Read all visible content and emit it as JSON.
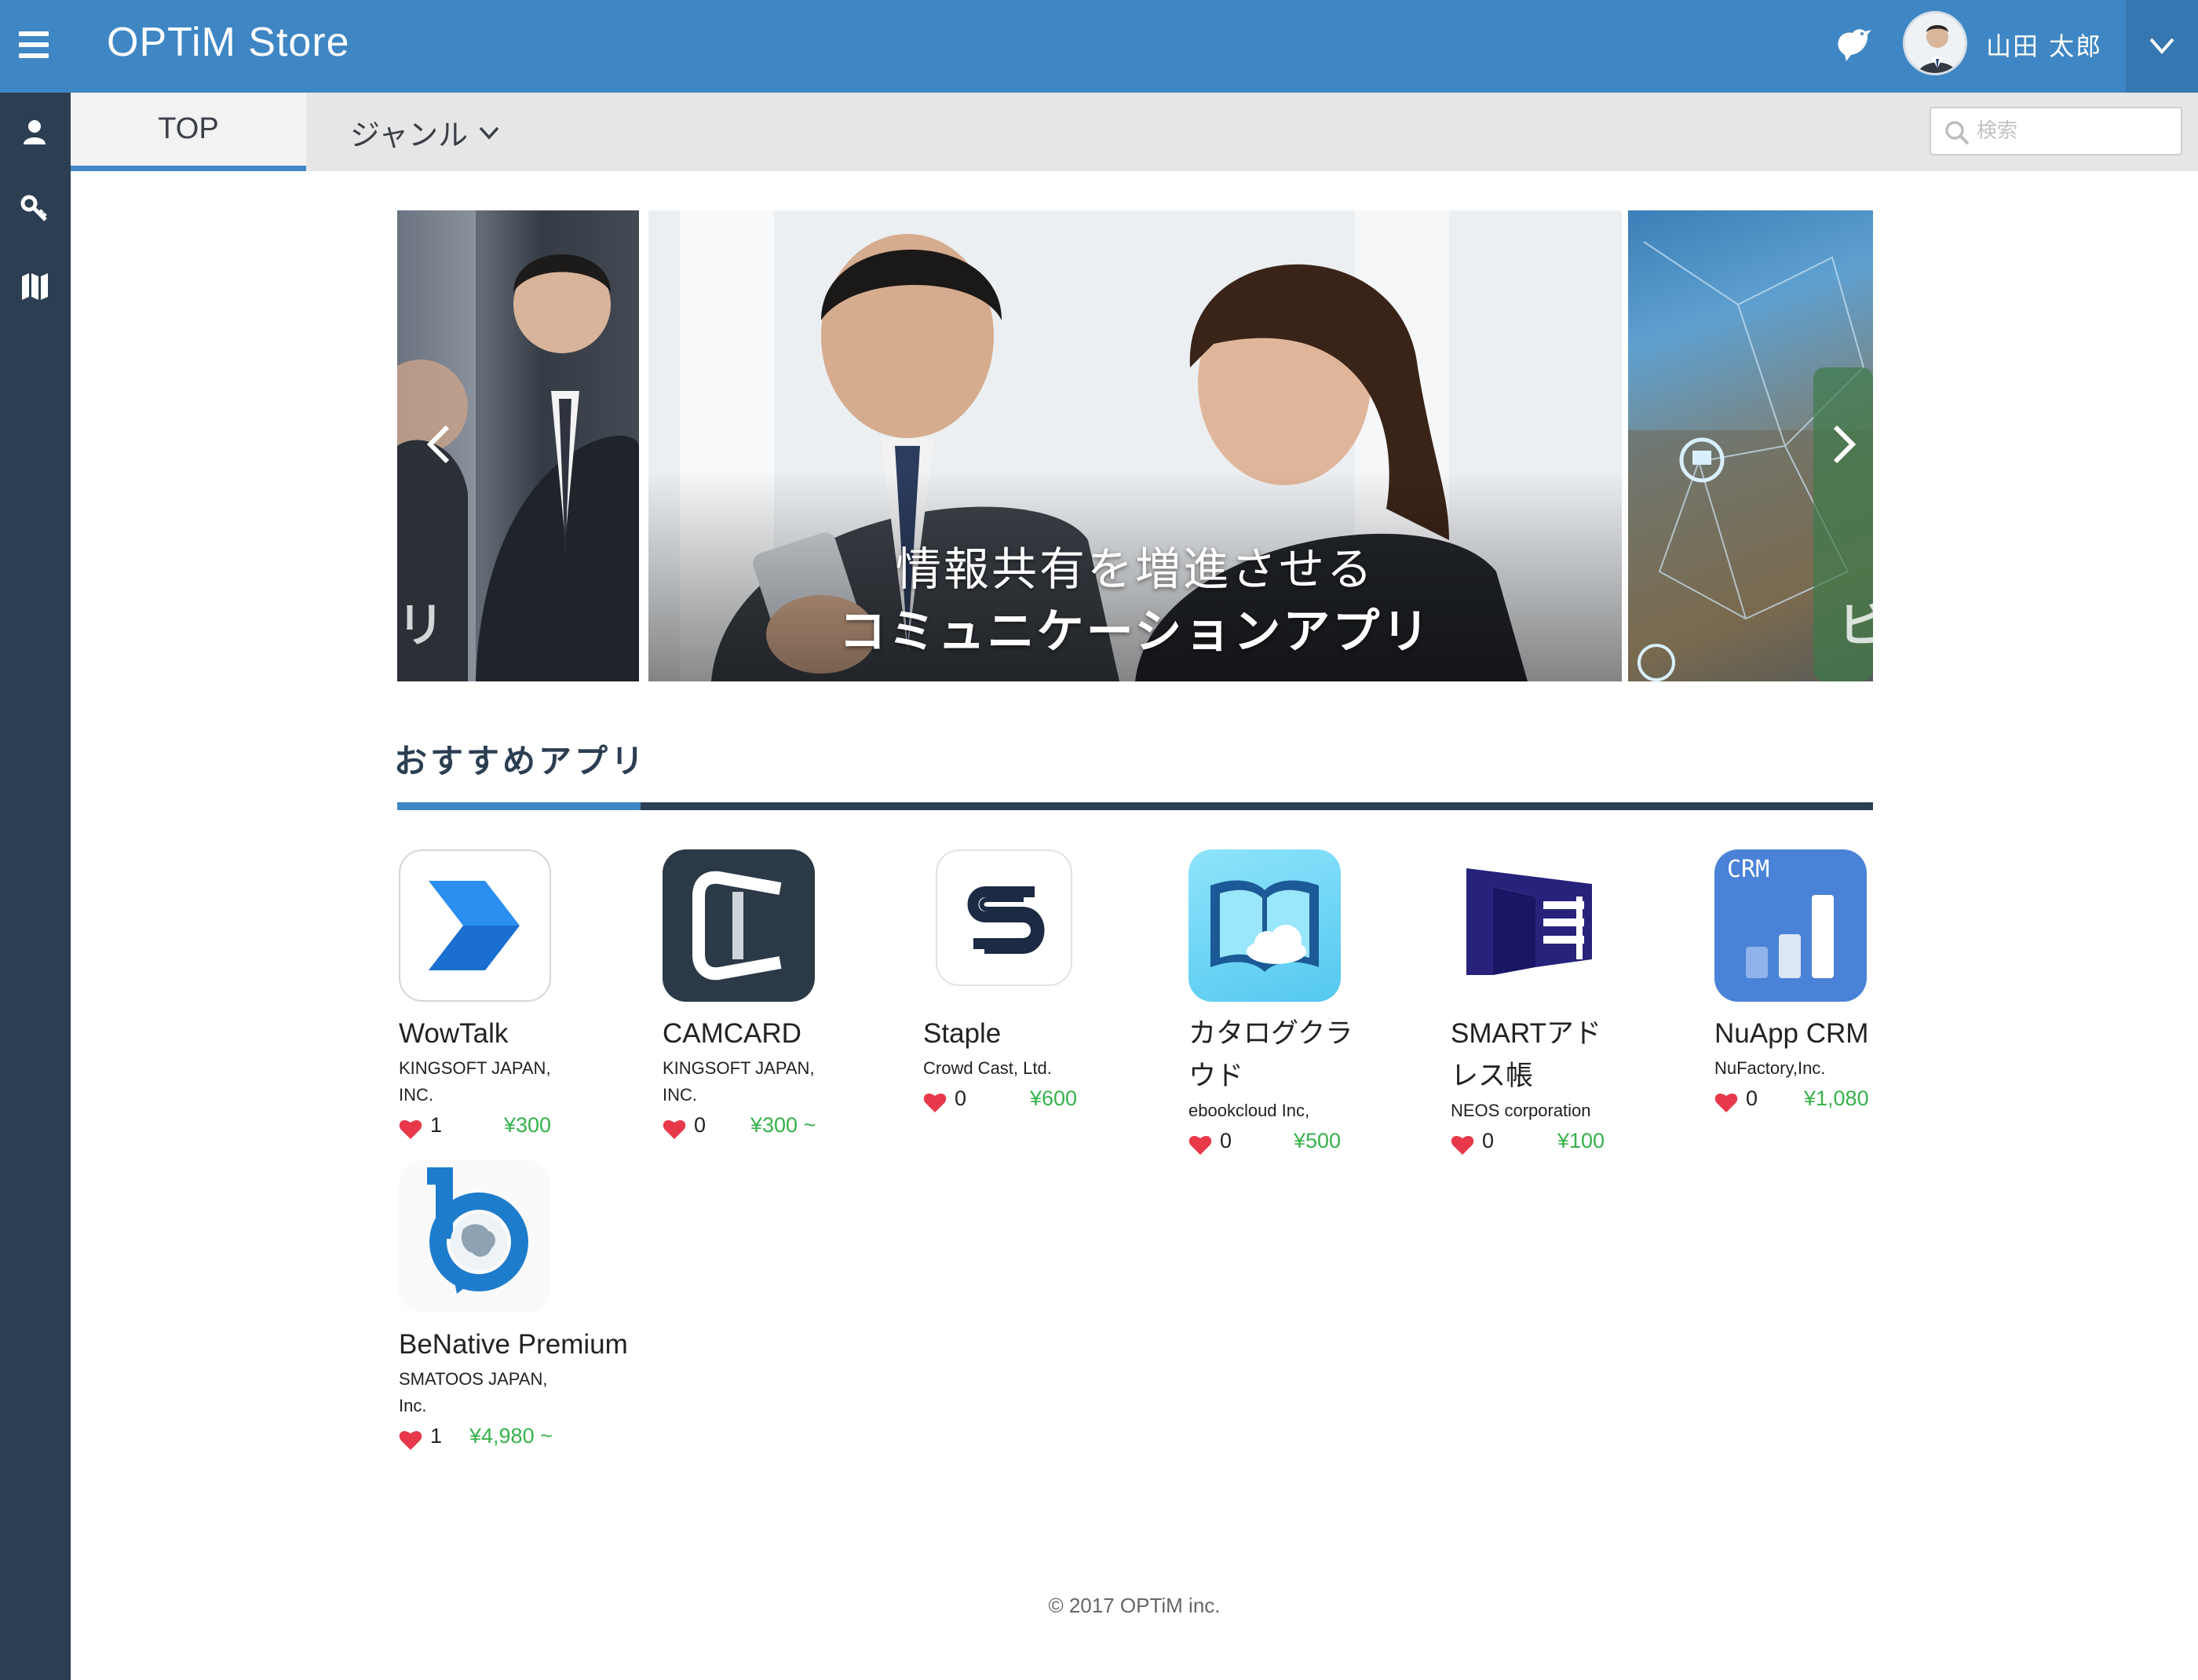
{
  "header": {
    "app_title": "OPTiM Store",
    "user_name": "山田 太郎"
  },
  "subnav": {
    "tab_top": "TOP",
    "tab_genre": "ジャンル",
    "search_placeholder": "検索"
  },
  "carousel": {
    "left_text": "リ",
    "main_caption_line1": "情報共有を増進させる",
    "main_caption_line2": "コミュニケーションアプリ",
    "right_text": "ビ"
  },
  "section": {
    "title": "おすすめアプリ"
  },
  "apps": [
    {
      "name": "WowTalk",
      "vendor": "KINGSOFT JAPAN, INC.",
      "likes": "1",
      "price": "¥300"
    },
    {
      "name": "CAMCARD",
      "vendor": "KINGSOFT JAPAN, INC.",
      "likes": "0",
      "price": "¥300 ~"
    },
    {
      "name": "Staple",
      "vendor": "Crowd Cast, Ltd.",
      "likes": "0",
      "price": "¥600"
    },
    {
      "name": "カタログクラウド",
      "vendor": "ebookcloud Inc,",
      "likes": "0",
      "price": "¥500"
    },
    {
      "name": "SMARTアドレス帳",
      "vendor": "NEOS corporation",
      "likes": "0",
      "price": "¥100"
    },
    {
      "name": "NuApp CRM",
      "vendor": "NuFactory,Inc.",
      "likes": "0",
      "price": "¥1,080"
    },
    {
      "name": "BeNative Premium",
      "vendor": "SMATOOS JAPAN, Inc.",
      "likes": "1",
      "price": "¥4,980 ~"
    }
  ],
  "crm_icon_label": "CRM",
  "footer": {
    "copyright": "© 2017 OPTiM inc."
  },
  "colors": {
    "header": "#3f87c4",
    "sidebar": "#2b3e52",
    "price": "#36b24a",
    "heart": "#e8394a"
  }
}
